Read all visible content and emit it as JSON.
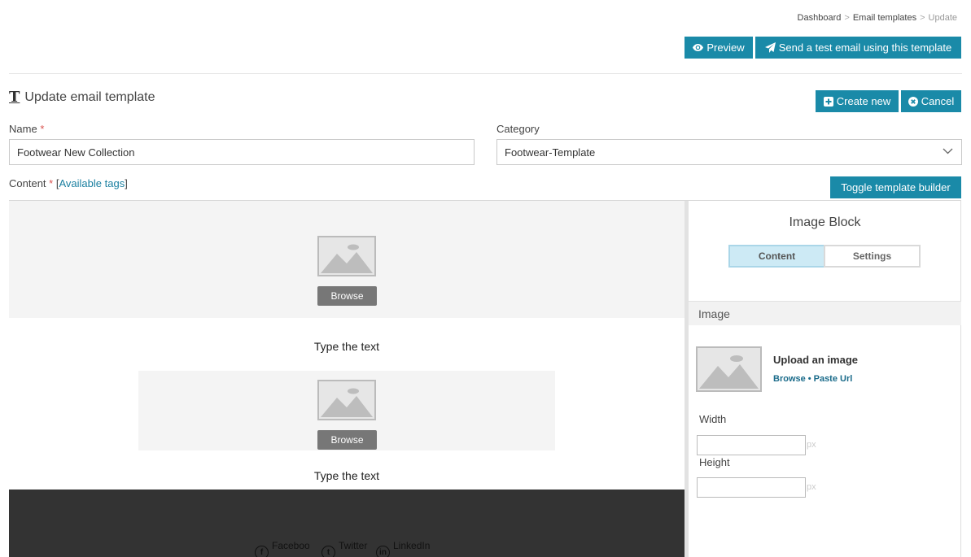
{
  "breadcrumb": {
    "items": [
      "Dashboard",
      "Email templates"
    ],
    "current": "Update",
    "separator": ">"
  },
  "top_actions": {
    "preview_label": "Preview",
    "send_test_label": "Send a test email using this template"
  },
  "page": {
    "title": "Update email template",
    "create_new_label": "Create new",
    "cancel_label": "Cancel"
  },
  "form": {
    "name_label": "Name",
    "name_value": "Footwear New Collection",
    "required_mark": "*",
    "category_label": "Category",
    "category_value": "Footwear-Template",
    "content_label": "Content",
    "available_tags_open": "[",
    "available_tags_label": "Available tags",
    "available_tags_close": "]",
    "toggle_builder_label": "Toggle template builder"
  },
  "canvas": {
    "browse_label": "Browse",
    "type_text_1": "Type the text",
    "type_text_2": "Type the text",
    "social": [
      {
        "icon": "facebook-icon",
        "glyph": "f",
        "label": "Facebook"
      },
      {
        "icon": "twitter-icon",
        "glyph": "t",
        "label": "Twitter"
      },
      {
        "icon": "linkedin-icon",
        "glyph": "in",
        "label": "LinkedIn"
      }
    ]
  },
  "panel": {
    "title": "Image Block",
    "tab_content": "Content",
    "tab_settings": "Settings",
    "section_image": "Image",
    "upload_title": "Upload an image",
    "browse_link": "Browse",
    "link_separator": "•",
    "paste_url_link": "Paste Url",
    "width_label": "Width",
    "height_label": "Height",
    "unit_px": "px"
  },
  "colors": {
    "accent": "#1a8aa8",
    "footer_dark": "#333333",
    "placeholder_bg": "#f4f4f4",
    "active_tab": "#cdeaf5"
  }
}
